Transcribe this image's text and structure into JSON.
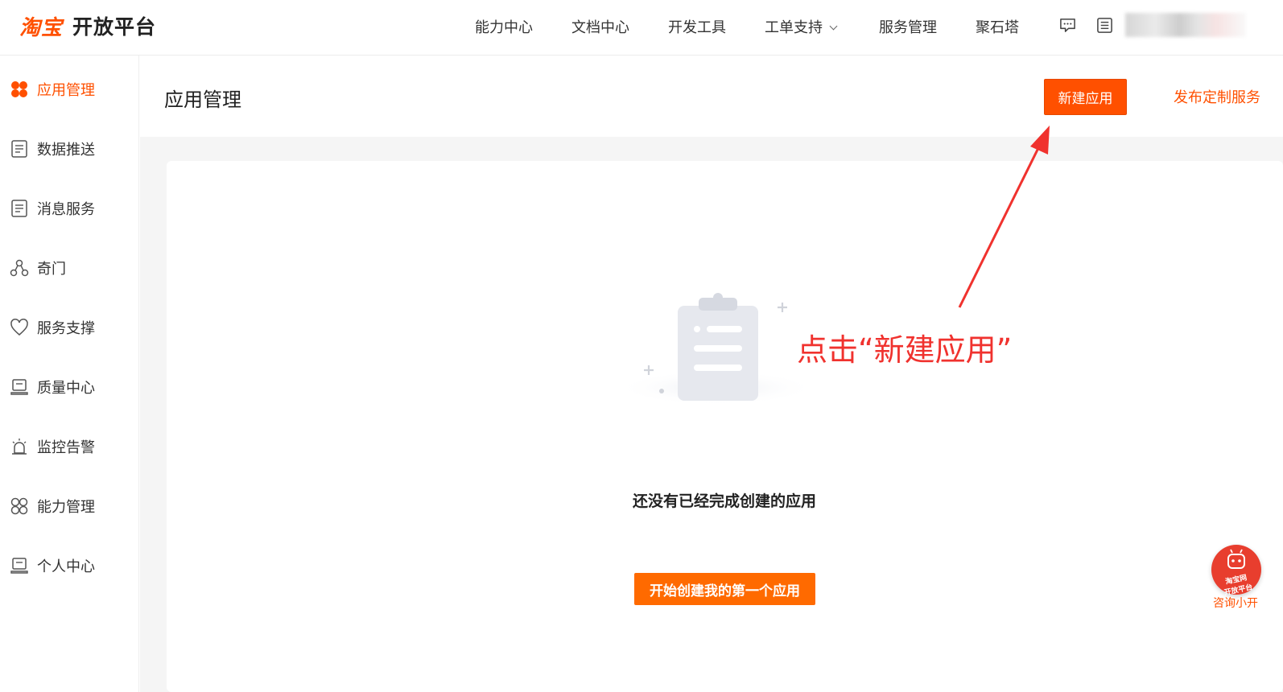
{
  "header": {
    "brand": "淘宝",
    "platform": "开放平台",
    "nav": [
      "能力中心",
      "文档中心",
      "开发工具",
      "工单支持",
      "服务管理",
      "聚石塔"
    ],
    "icons": [
      "message-icon",
      "list-icon"
    ]
  },
  "sidebar": {
    "items": [
      {
        "label": "应用管理",
        "icon": "apps-icon",
        "active": true
      },
      {
        "label": "数据推送",
        "icon": "document-icon"
      },
      {
        "label": "消息服务",
        "icon": "document-icon"
      },
      {
        "label": "奇门",
        "icon": "network-icon"
      },
      {
        "label": "服务支撑",
        "icon": "heart-icon"
      },
      {
        "label": "质量中心",
        "icon": "stack-icon"
      },
      {
        "label": "监控告警",
        "icon": "alarm-icon"
      },
      {
        "label": "能力管理",
        "icon": "grid-icon"
      },
      {
        "label": "个人中心",
        "icon": "stack-icon"
      }
    ]
  },
  "main": {
    "title": "应用管理",
    "new_app_button": "新建应用",
    "publish_link": "发布定制服务",
    "empty_text": "还没有已经完成创建的应用",
    "start_button": "开始创建我的第一个应用"
  },
  "annotation": {
    "text": "点击“新建应用”",
    "color": "#f0322e"
  },
  "consult": {
    "label": "咨询小开",
    "badge_line1": "淘宝网",
    "badge_line2": "开放平台"
  },
  "colors": {
    "accent": "#ff5000",
    "button": "#ff6a00"
  }
}
